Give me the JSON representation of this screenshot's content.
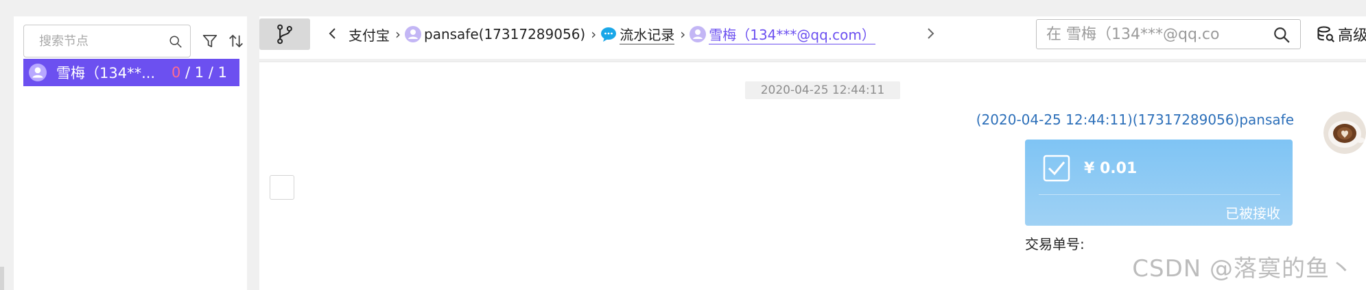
{
  "tree_panel": {
    "search_placeholder": "搜索节点",
    "filter_icon": "filter-icon",
    "sort_icon": "sort-icon",
    "selected_item": {
      "label": "雪梅（134**...",
      "count_zero": "0",
      "count_rest": " / 1 / 1"
    }
  },
  "toolbar": {
    "branch_icon": "branch-icon",
    "breadcrumbs": [
      {
        "label": "支付宝",
        "icon": ""
      },
      {
        "label": "pansafe(17317289056)",
        "icon": "user-icon"
      },
      {
        "label": "流水记录",
        "icon": "chat-bubble-icon"
      },
      {
        "label": "雪梅（134***@qq.com）",
        "icon": "user-icon"
      }
    ],
    "search_placeholder": "在 雪梅（134***@qq.co",
    "advanced_label": "高级"
  },
  "chat": {
    "time_divider": "2020-04-25 12:44:11",
    "message": {
      "header": "(2020-04-25 12:44:11)(17317289056)pansafe",
      "amount": "¥ 0.01",
      "status": "已被接收",
      "txn_label": "交易单号:"
    }
  },
  "watermark": "CSDN @落寞的鱼丶",
  "colors": {
    "accent": "#6c50f0",
    "card": "#87c8f4",
    "link": "#2c6fb9",
    "zero_count": "#ff6b8f"
  }
}
